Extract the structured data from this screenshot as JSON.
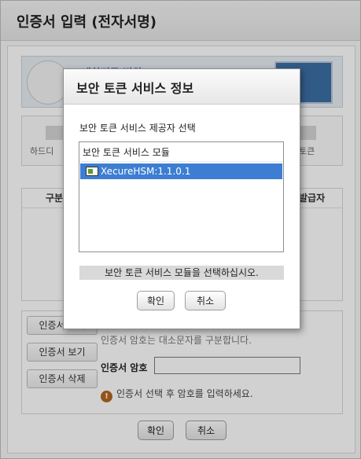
{
  "window": {
    "title": "인증서 입력 (전자서명)"
  },
  "banner": {
    "org_text": "대한민국 법원"
  },
  "drives": [
    {
      "label": "하드디"
    },
    {
      "label": "토큰"
    }
  ],
  "cert_table": {
    "columns": [
      "구분",
      "발급자"
    ]
  },
  "side_buttons": {
    "find": "인증서 찾기",
    "view": "인증서 보기",
    "delete": "인증서 삭제"
  },
  "password": {
    "case_note": "인증서 암호는 대소문자를 구분합니다.",
    "label": "인증서 암호",
    "value": "",
    "hint": "인증서 선택 후 암호를 입력하세요."
  },
  "main_buttons": {
    "ok": "확인",
    "cancel": "취소"
  },
  "dialog": {
    "title": "보안 토큰 서비스 정보",
    "select_label": "보안 토큰 서비스 제공자 선택",
    "list_header": "보안 토큰 서비스 모듈",
    "items": [
      "XecureHSM:1.1.0.1"
    ],
    "status": "보안 토큰 서비스 모듈을 선택하십시오.",
    "ok": "확인",
    "cancel": "취소"
  },
  "icons": {
    "hint": "warning-icon",
    "module": "chip-icon"
  },
  "colors": {
    "selection": "#3d7ed2",
    "status_bar": "#d9d9d9",
    "hint_icon": "#b5651d"
  }
}
